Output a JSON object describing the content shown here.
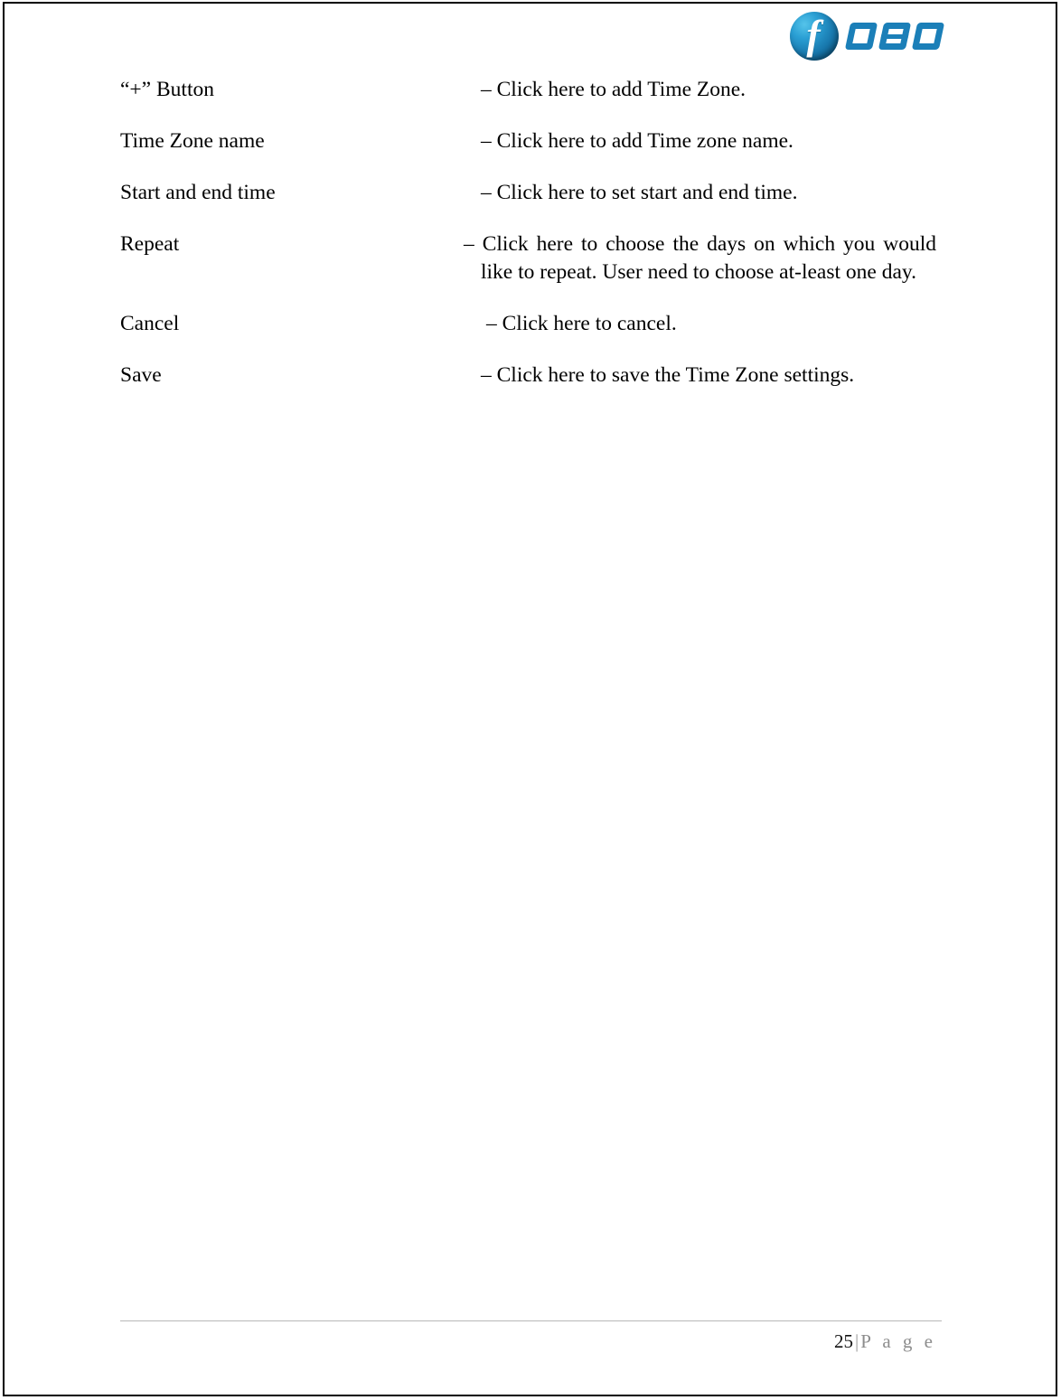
{
  "document": {
    "logo": {
      "badge_letter": "f",
      "wordmark": "OBO",
      "brand_name": "FOBO",
      "brand_color": "#1b7fb8",
      "badge_gradient_light": "#55c4ea",
      "badge_gradient_dark": "#073a58"
    },
    "definitions": [
      {
        "term": "“+” Button",
        "description": "– Click here to add Time Zone."
      },
      {
        "term": "Time Zone name",
        "description": "– Click here to add Time zone name."
      },
      {
        "term": "Start and end time",
        "description": "– Click here to set start and end time."
      },
      {
        "term": "Repeat",
        "description": "– Click here to choose the days on which you would like to repeat. User need to choose at-least one day."
      },
      {
        "term": "Cancel",
        "description": "– Click here to cancel."
      },
      {
        "term": "Save",
        "description": "– Click here to save the Time Zone settings."
      }
    ],
    "footer": {
      "page_number": "25",
      "separator": "|",
      "page_word": "P a g e"
    }
  }
}
